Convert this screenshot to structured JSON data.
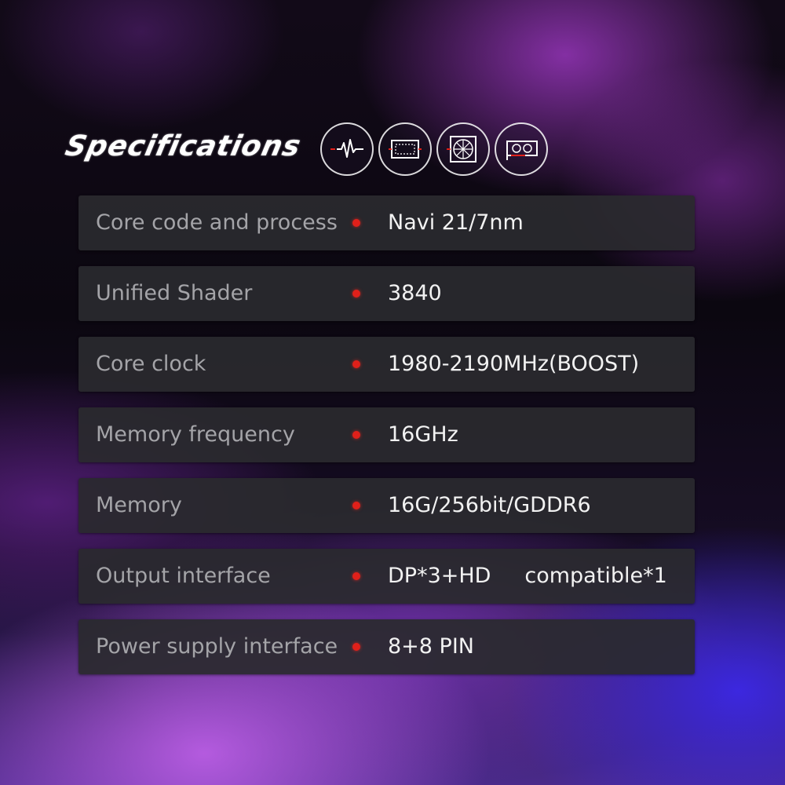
{
  "header": {
    "title": "Specifications",
    "icons": [
      "pulse-icon",
      "circuit-board-icon",
      "fan-icon",
      "graphics-card-icon"
    ]
  },
  "colors": {
    "accent_dot": "#e0201a",
    "row_background": "#2a2a2e",
    "label_text": "#a4a4a8",
    "value_text": "#f2f2f2"
  },
  "specs": [
    {
      "label": "Core code and process",
      "value": "Navi 21/7nm"
    },
    {
      "label": "Unified Shader",
      "value": "3840"
    },
    {
      "label": "Core clock",
      "value": "1980-2190MHz(BOOST)"
    },
    {
      "label": "Memory frequency",
      "value": "16GHz"
    },
    {
      "label": "Memory",
      "value": "16G/256bit/GDDR6"
    },
    {
      "label": "Output interface",
      "value": "DP*3+HD     compatible*1"
    },
    {
      "label": "Power supply interface",
      "value": "8+8 PIN"
    }
  ]
}
